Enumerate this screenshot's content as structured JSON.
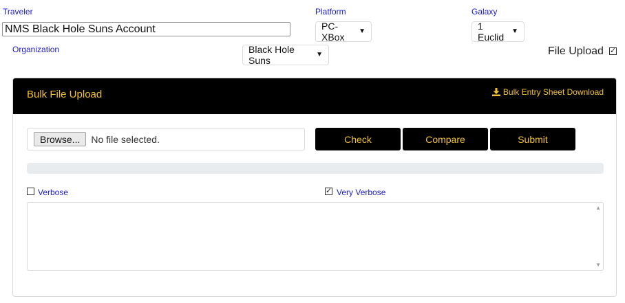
{
  "traveler": {
    "label": "Traveler",
    "value": "NMS Black Hole Suns Account"
  },
  "platform": {
    "label": "Platform",
    "selected": "PC-XBox"
  },
  "galaxy": {
    "label": "Galaxy",
    "selected": "1 Euclid"
  },
  "organization": {
    "label": "Organization",
    "selected": "Black Hole Suns"
  },
  "file_upload": {
    "label": "File Upload",
    "checked": true
  },
  "bulk": {
    "title": "Bulk File Upload",
    "download_link": "Bulk Entry Sheet Download",
    "browse_label": "Browse...",
    "file_status": "No file selected.",
    "check_label": "Check",
    "compare_label": "Compare",
    "submit_label": "Submit",
    "progress": 0,
    "verbose_label": "Verbose",
    "verbose_checked": false,
    "very_verbose_label": "Very Verbose",
    "very_verbose_checked": true,
    "log_text": ""
  },
  "colors": {
    "accent": "#f2c230",
    "header_bg": "#000000",
    "link_blue": "#1a1ad0"
  },
  "icons": {
    "dropdown": "caret-down-icon",
    "download": "download-icon",
    "checkbox": "checkbox-icon"
  }
}
